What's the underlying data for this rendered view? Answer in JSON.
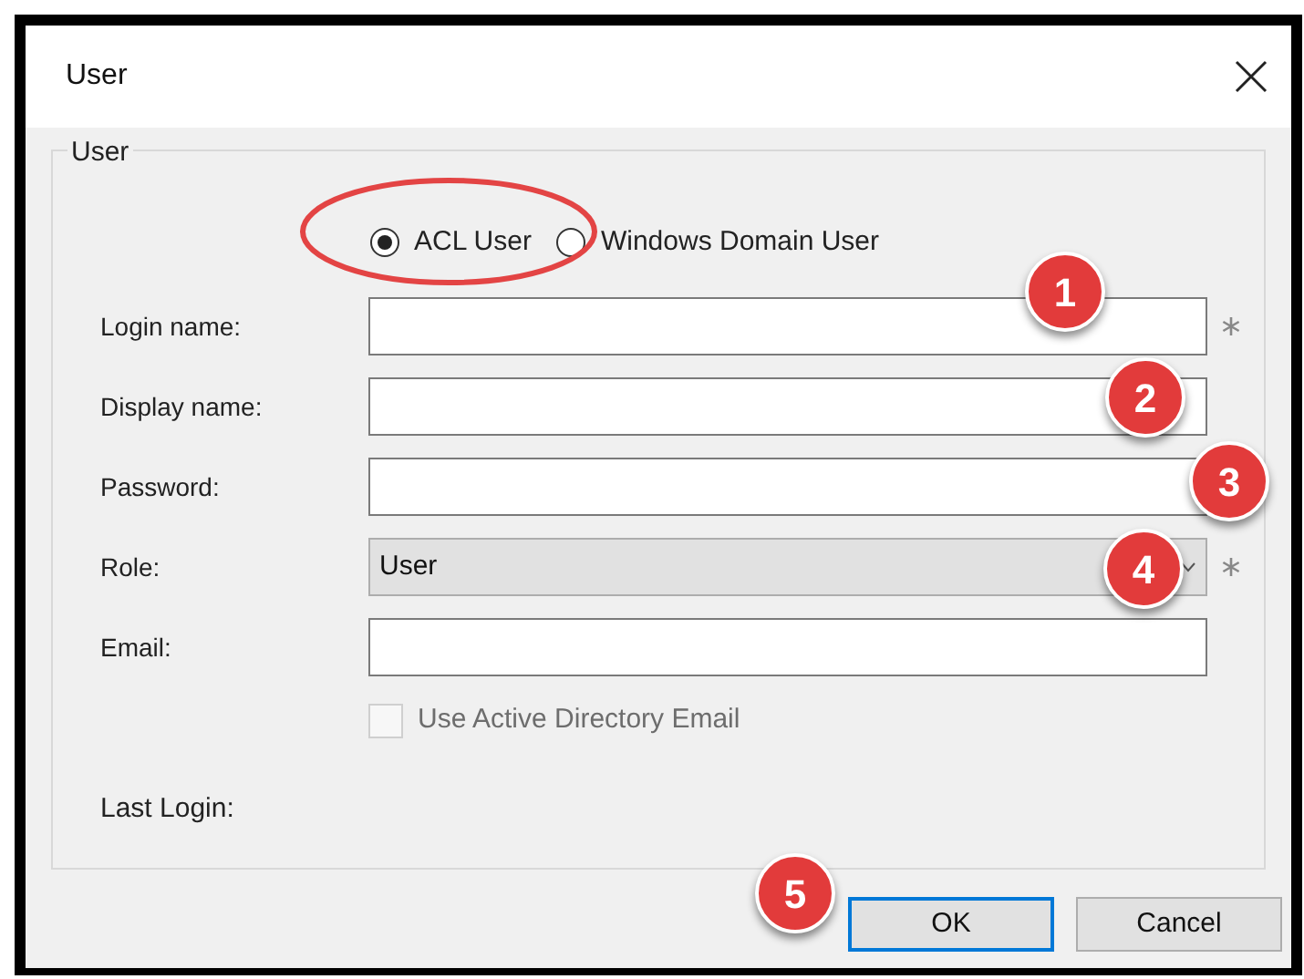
{
  "window": {
    "title": "User"
  },
  "group": {
    "title": "User"
  },
  "user_type": [
    {
      "label": "ACL User",
      "selected": true
    },
    {
      "label": "Windows Domain User",
      "selected": false
    }
  ],
  "fields": [
    {
      "label": "Login name:",
      "kind": "text",
      "required": true
    },
    {
      "label": "Display name:",
      "kind": "text",
      "required": false
    },
    {
      "label": "Password:",
      "kind": "text",
      "required": false
    },
    {
      "label": "Role:",
      "kind": "select",
      "value": "User",
      "required": true
    },
    {
      "label": "Email:",
      "kind": "text",
      "required": false
    }
  ],
  "use_ad_email": {
    "label": "Use Active Directory Email",
    "checked": false,
    "disabled": true
  },
  "last_login": {
    "label": "Last Login:"
  },
  "buttons": [
    {
      "label": "OK",
      "default": true
    },
    {
      "label": "Cancel",
      "default": false
    }
  ],
  "annotations": [
    "1",
    "2",
    "3",
    "4",
    "5"
  ]
}
